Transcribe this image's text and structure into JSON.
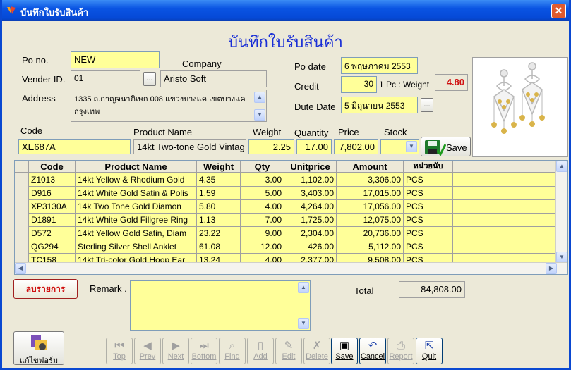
{
  "window": {
    "title": "บันทึกใบรับสินค้า"
  },
  "form_title": "บันทึกใบรับสินค้า",
  "header": {
    "po_no_label": "Po no.",
    "po_no_value": "NEW",
    "company_label": "Company",
    "vender_label": "Vender ID.",
    "vender_value": "01",
    "vender_lookup": "...",
    "company_value": "Aristo Soft",
    "address_label": "Address",
    "address_value": "1335 ถ.กาญจนาภิเษก 008 แขวงบางแค เขตบางแค กรุงเทพ",
    "po_date_label": "Po date",
    "po_date_value": "6 พฤษภาคม 2553",
    "credit_label": "Credit",
    "credit_value": "30",
    "pc_weight_label": "1 Pc : Weight",
    "pc_weight_value": "4.80",
    "due_date_label": "Dute Date",
    "due_date_value": "5 มิถุนายน 2553",
    "due_date_lookup": "..."
  },
  "entry": {
    "code_label": "Code",
    "code_value": "XE687A",
    "product_label": "Product Name",
    "product_value": "14kt Two-tone Gold Vintag",
    "weight_label": "Weight",
    "weight_value": "2.25",
    "quantity_label": "Quantity",
    "quantity_value": "17.00",
    "price_label": "Price",
    "price_value": "7,802.00",
    "stock_label": "Stock",
    "save_label": "Save"
  },
  "grid": {
    "columns": [
      "Code",
      "Product Name",
      "Weight",
      "Qty",
      "Unitprice",
      "Amount",
      "หน่วยนับ"
    ],
    "rows": [
      [
        "Z1013",
        "14kt Yellow & Rhodium Gold",
        "4.35",
        "3.00",
        "1,102.00",
        "3,306.00",
        "PCS"
      ],
      [
        "D916",
        "14kt White Gold Satin & Polis",
        "1.59",
        "5.00",
        "3,403.00",
        "17,015.00",
        "PCS"
      ],
      [
        "XP3130A",
        "14k Two Tone Gold Diamon",
        "5.80",
        "4.00",
        "4,264.00",
        "17,056.00",
        "PCS"
      ],
      [
        "D1891",
        "14kt White Gold Filigree Ring",
        "1.13",
        "7.00",
        "1,725.00",
        "12,075.00",
        "PCS"
      ],
      [
        "D572",
        "14kt Yellow Gold Satin, Diam",
        "23.22",
        "9.00",
        "2,304.00",
        "20,736.00",
        "PCS"
      ],
      [
        "QG294",
        "Sterling Silver Shell Anklet",
        "61.08",
        "12.00",
        "426.00",
        "5,112.00",
        "PCS"
      ],
      [
        "TC158",
        "14kt Tri-color Gold Hoop Ear",
        "13.24",
        "4.00",
        "2,377.00",
        "9,508.00",
        "PCS"
      ]
    ]
  },
  "footer": {
    "delete_item_label": "ลบรายการ",
    "remark_label": "Remark .",
    "total_label": "Total",
    "total_value": "84,808.00",
    "edit_form_label": "แก้ไขฟอร์ม"
  },
  "toolbar": {
    "buttons": [
      {
        "label": "Top"
      },
      {
        "label": "Prev"
      },
      {
        "label": "Next"
      },
      {
        "label": "Bottom"
      },
      {
        "label": "Find"
      },
      {
        "label": "Add"
      },
      {
        "label": "Edit"
      },
      {
        "label": "Delete"
      },
      {
        "label": "Save"
      },
      {
        "label": "Cancel"
      },
      {
        "label": "Report"
      },
      {
        "label": "Quit"
      }
    ]
  },
  "colors": {
    "accent": "#1a2fd6",
    "field": "#ffff99",
    "alert": "#d01010"
  }
}
